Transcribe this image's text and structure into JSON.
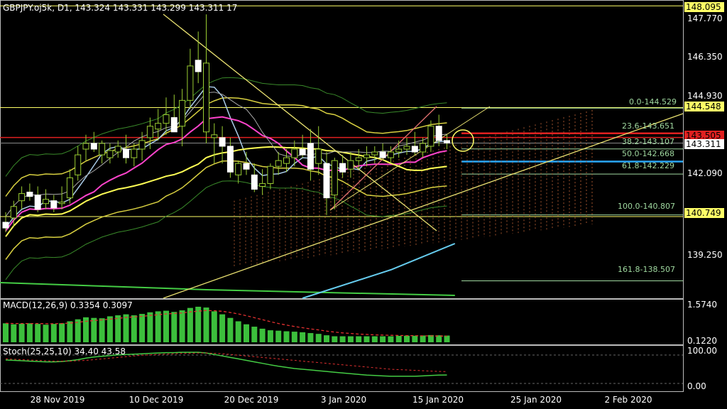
{
  "header": {
    "price_title": "GBPJPY.oj5k, D1, 143.324 143.331 143.299 143.311 17",
    "macd_title": "MACD(12,26,9) 0.3354 0.3097",
    "stoch_title": "Stoch(25,25,10) 34.40 43.58"
  },
  "price_axis": {
    "ticks": [
      "147.770",
      "146.350",
      "144.930",
      "142.090",
      "139.250"
    ],
    "badges": [
      {
        "text": "148.095",
        "bg": "#ffff66",
        "fg": "#000000"
      },
      {
        "text": "144.548",
        "bg": "#ffff66",
        "fg": "#000000"
      },
      {
        "text": "143.505",
        "bg": "#e02020",
        "fg": "#000000"
      },
      {
        "text": "143.311",
        "bg": "#ffffff",
        "fg": "#000000"
      },
      {
        "text": "140.749",
        "bg": "#ffff66",
        "fg": "#000000"
      }
    ]
  },
  "macd_axis": {
    "ticks": [
      "1.5740",
      "0.1220"
    ]
  },
  "stoch_axis": {
    "ticks": [
      "100.00",
      "0.00"
    ]
  },
  "time_axis": {
    "labels": [
      "28 Nov 2019",
      "10 Dec 2019",
      "20 Dec 2019",
      "3 Jan 2020",
      "15 Jan 2020",
      "25 Jan 2020",
      "2 Feb 2020"
    ]
  },
  "fibonacci": [
    {
      "label": "0.0-144.529",
      "price": 144.529
    },
    {
      "label": "23.6-143.651",
      "price": 143.651
    },
    {
      "label": "38.2-143.107",
      "price": 143.107
    },
    {
      "label": "50.0-142.668",
      "price": 142.668
    },
    {
      "label": "61.8-142.229",
      "price": 142.229
    },
    {
      "label": "100.0-140.807",
      "price": 140.807
    },
    {
      "label": "161.8-138.507",
      "price": 138.507
    }
  ],
  "colors": {
    "background": "#000000",
    "bull_candle": "#ffffff",
    "bear_candle": "#ffffff",
    "macd_hist": "#3cbf3c",
    "macd_signal": "#e03030",
    "stoch_main": "#44cc44",
    "stoch_signal": "#e03030",
    "fib": "#9fd89f",
    "ma_pink": "#ff44cc",
    "ma_yellow": "#ffff55",
    "ma_blue": "#66ccee",
    "ma_green": "#44cc44"
  },
  "chart_data": {
    "type": "candlestick",
    "symbol": "GBPJPY.oj5k",
    "timeframe": "D1",
    "ohlc_header": {
      "open": 143.324,
      "high": 143.331,
      "low": 143.299,
      "close": 143.311
    },
    "ylim": [
      137.9,
      148.3
    ],
    "candles": [
      {
        "o": 140.55,
        "h": 140.9,
        "l": 140.2,
        "c": 140.35
      },
      {
        "o": 140.7,
        "h": 141.3,
        "l": 140.4,
        "c": 141.1
      },
      {
        "o": 141.3,
        "h": 141.8,
        "l": 141.0,
        "c": 141.55
      },
      {
        "o": 141.6,
        "h": 141.9,
        "l": 141.3,
        "c": 141.45
      },
      {
        "o": 141.5,
        "h": 141.8,
        "l": 140.9,
        "c": 141.0
      },
      {
        "o": 141.2,
        "h": 141.7,
        "l": 141.0,
        "c": 141.35
      },
      {
        "o": 141.3,
        "h": 141.5,
        "l": 140.9,
        "c": 141.05
      },
      {
        "o": 141.2,
        "h": 141.8,
        "l": 141.0,
        "c": 141.25
      },
      {
        "o": 141.4,
        "h": 142.4,
        "l": 141.2,
        "c": 142.1
      },
      {
        "o": 142.2,
        "h": 143.2,
        "l": 142.0,
        "c": 142.9
      },
      {
        "o": 143.1,
        "h": 143.6,
        "l": 142.7,
        "c": 143.3
      },
      {
        "o": 143.3,
        "h": 143.7,
        "l": 143.0,
        "c": 143.1
      },
      {
        "o": 142.9,
        "h": 143.4,
        "l": 142.6,
        "c": 143.3
      },
      {
        "o": 142.8,
        "h": 143.3,
        "l": 142.6,
        "c": 143.05
      },
      {
        "o": 143.0,
        "h": 143.4,
        "l": 142.8,
        "c": 143.2
      },
      {
        "o": 143.1,
        "h": 143.6,
        "l": 142.6,
        "c": 142.8
      },
      {
        "o": 142.8,
        "h": 143.3,
        "l": 142.5,
        "c": 143.1
      },
      {
        "o": 143.1,
        "h": 143.7,
        "l": 142.7,
        "c": 143.4
      },
      {
        "o": 143.5,
        "h": 144.2,
        "l": 143.1,
        "c": 143.9
      },
      {
        "o": 143.8,
        "h": 144.5,
        "l": 143.4,
        "c": 144.0
      },
      {
        "o": 144.0,
        "h": 144.9,
        "l": 143.6,
        "c": 144.3
      },
      {
        "o": 144.2,
        "h": 145.0,
        "l": 143.8,
        "c": 143.7
      },
      {
        "o": 143.9,
        "h": 145.2,
        "l": 143.2,
        "c": 144.8
      },
      {
        "o": 144.8,
        "h": 146.6,
        "l": 144.5,
        "c": 146.0
      },
      {
        "o": 146.2,
        "h": 147.2,
        "l": 145.4,
        "c": 145.8
      },
      {
        "o": 143.7,
        "h": 147.8,
        "l": 143.3,
        "c": 146.1
      },
      {
        "o": 143.5,
        "h": 144.0,
        "l": 142.6,
        "c": 143.6
      },
      {
        "o": 143.5,
        "h": 143.9,
        "l": 142.6,
        "c": 143.2
      },
      {
        "o": 143.2,
        "h": 143.5,
        "l": 142.1,
        "c": 142.3
      },
      {
        "o": 142.2,
        "h": 142.7,
        "l": 141.9,
        "c": 142.6
      },
      {
        "o": 142.6,
        "h": 143.0,
        "l": 142.2,
        "c": 142.4
      },
      {
        "o": 142.2,
        "h": 142.6,
        "l": 141.6,
        "c": 141.7
      },
      {
        "o": 141.8,
        "h": 142.4,
        "l": 141.5,
        "c": 141.9
      },
      {
        "o": 141.9,
        "h": 142.6,
        "l": 141.7,
        "c": 142.5
      },
      {
        "o": 142.5,
        "h": 143.0,
        "l": 142.2,
        "c": 142.7
      },
      {
        "o": 142.6,
        "h": 143.1,
        "l": 142.3,
        "c": 142.8
      },
      {
        "o": 142.8,
        "h": 143.4,
        "l": 142.5,
        "c": 143.1
      },
      {
        "o": 143.1,
        "h": 143.6,
        "l": 142.8,
        "c": 142.9
      },
      {
        "o": 143.3,
        "h": 143.8,
        "l": 142.0,
        "c": 142.4
      },
      {
        "o": 142.6,
        "h": 143.9,
        "l": 142.2,
        "c": 143.1
      },
      {
        "o": 142.6,
        "h": 143.0,
        "l": 140.8,
        "c": 141.4
      },
      {
        "o": 141.5,
        "h": 142.8,
        "l": 141.0,
        "c": 142.7
      },
      {
        "o": 142.6,
        "h": 142.9,
        "l": 142.1,
        "c": 142.3
      },
      {
        "o": 142.4,
        "h": 143.0,
        "l": 142.1,
        "c": 142.7
      },
      {
        "o": 142.7,
        "h": 143.1,
        "l": 142.4,
        "c": 142.8
      },
      {
        "o": 142.8,
        "h": 143.2,
        "l": 142.5,
        "c": 142.9
      },
      {
        "o": 142.9,
        "h": 143.2,
        "l": 142.6,
        "c": 143.0
      },
      {
        "o": 143.0,
        "h": 143.3,
        "l": 142.7,
        "c": 142.8
      },
      {
        "o": 142.8,
        "h": 143.2,
        "l": 142.6,
        "c": 143.0
      },
      {
        "o": 143.0,
        "h": 143.4,
        "l": 142.8,
        "c": 143.1
      },
      {
        "o": 143.1,
        "h": 143.5,
        "l": 142.9,
        "c": 143.2
      },
      {
        "o": 143.2,
        "h": 143.7,
        "l": 142.9,
        "c": 143.0
      },
      {
        "o": 143.0,
        "h": 143.5,
        "l": 142.8,
        "c": 143.3
      },
      {
        "o": 143.2,
        "h": 144.1,
        "l": 143.0,
        "c": 143.9
      },
      {
        "o": 143.9,
        "h": 144.3,
        "l": 143.2,
        "c": 143.4
      },
      {
        "o": 143.4,
        "h": 143.6,
        "l": 143.1,
        "c": 143.31
      }
    ],
    "macd": {
      "histogram": [
        0.95,
        0.9,
        0.93,
        0.95,
        0.92,
        0.88,
        0.92,
        0.95,
        1.05,
        1.15,
        1.25,
        1.22,
        1.2,
        1.3,
        1.35,
        1.4,
        1.35,
        1.42,
        1.5,
        1.55,
        1.58,
        1.52,
        1.6,
        1.72,
        1.78,
        1.74,
        1.55,
        1.4,
        1.22,
        1.05,
        0.9,
        0.78,
        0.68,
        0.6,
        0.58,
        0.55,
        0.53,
        0.5,
        0.46,
        0.42,
        0.35,
        0.3,
        0.3,
        0.3,
        0.3,
        0.3,
        0.3,
        0.3,
        0.3,
        0.32,
        0.33,
        0.33,
        0.34,
        0.36,
        0.35,
        0.3354
      ],
      "signal": [
        0.95,
        0.94,
        0.94,
        0.94,
        0.94,
        0.93,
        0.93,
        0.94,
        0.96,
        1.0,
        1.05,
        1.09,
        1.12,
        1.16,
        1.2,
        1.24,
        1.27,
        1.3,
        1.34,
        1.38,
        1.42,
        1.44,
        1.47,
        1.52,
        1.56,
        1.59,
        1.58,
        1.55,
        1.49,
        1.42,
        1.33,
        1.23,
        1.13,
        1.03,
        0.94,
        0.86,
        0.79,
        0.73,
        0.67,
        0.62,
        0.56,
        0.51,
        0.47,
        0.44,
        0.41,
        0.39,
        0.37,
        0.36,
        0.35,
        0.34,
        0.33,
        0.33,
        0.32,
        0.32,
        0.31,
        0.3097
      ],
      "ylim": [
        0.0,
        1.85
      ]
    },
    "stochastic": {
      "main": [
        75,
        74,
        73,
        72,
        71,
        70,
        70,
        71,
        73,
        76,
        80,
        83,
        85,
        87,
        89,
        90,
        91,
        92,
        93,
        94,
        95,
        95,
        96,
        96,
        96,
        94,
        90,
        86,
        82,
        78,
        74,
        70,
        66,
        62,
        58,
        55,
        52,
        50,
        48,
        46,
        44,
        42,
        40,
        38,
        36,
        34,
        33,
        32,
        31,
        31,
        31,
        31,
        32,
        33,
        34,
        34.4
      ],
      "signal": [
        78,
        77,
        76,
        75,
        74,
        73,
        72,
        72,
        72,
        73,
        74,
        76,
        78,
        80,
        82,
        84,
        86,
        88,
        89,
        90,
        91,
        92,
        93,
        93,
        94,
        94,
        93,
        92,
        90,
        88,
        86,
        84,
        82,
        80,
        78,
        76,
        74,
        72,
        70,
        68,
        66,
        64,
        62,
        60,
        58,
        56,
        54,
        52,
        50,
        49,
        48,
        47,
        46,
        45,
        44,
        43.58
      ],
      "ylim": [
        0,
        100
      ]
    }
  }
}
